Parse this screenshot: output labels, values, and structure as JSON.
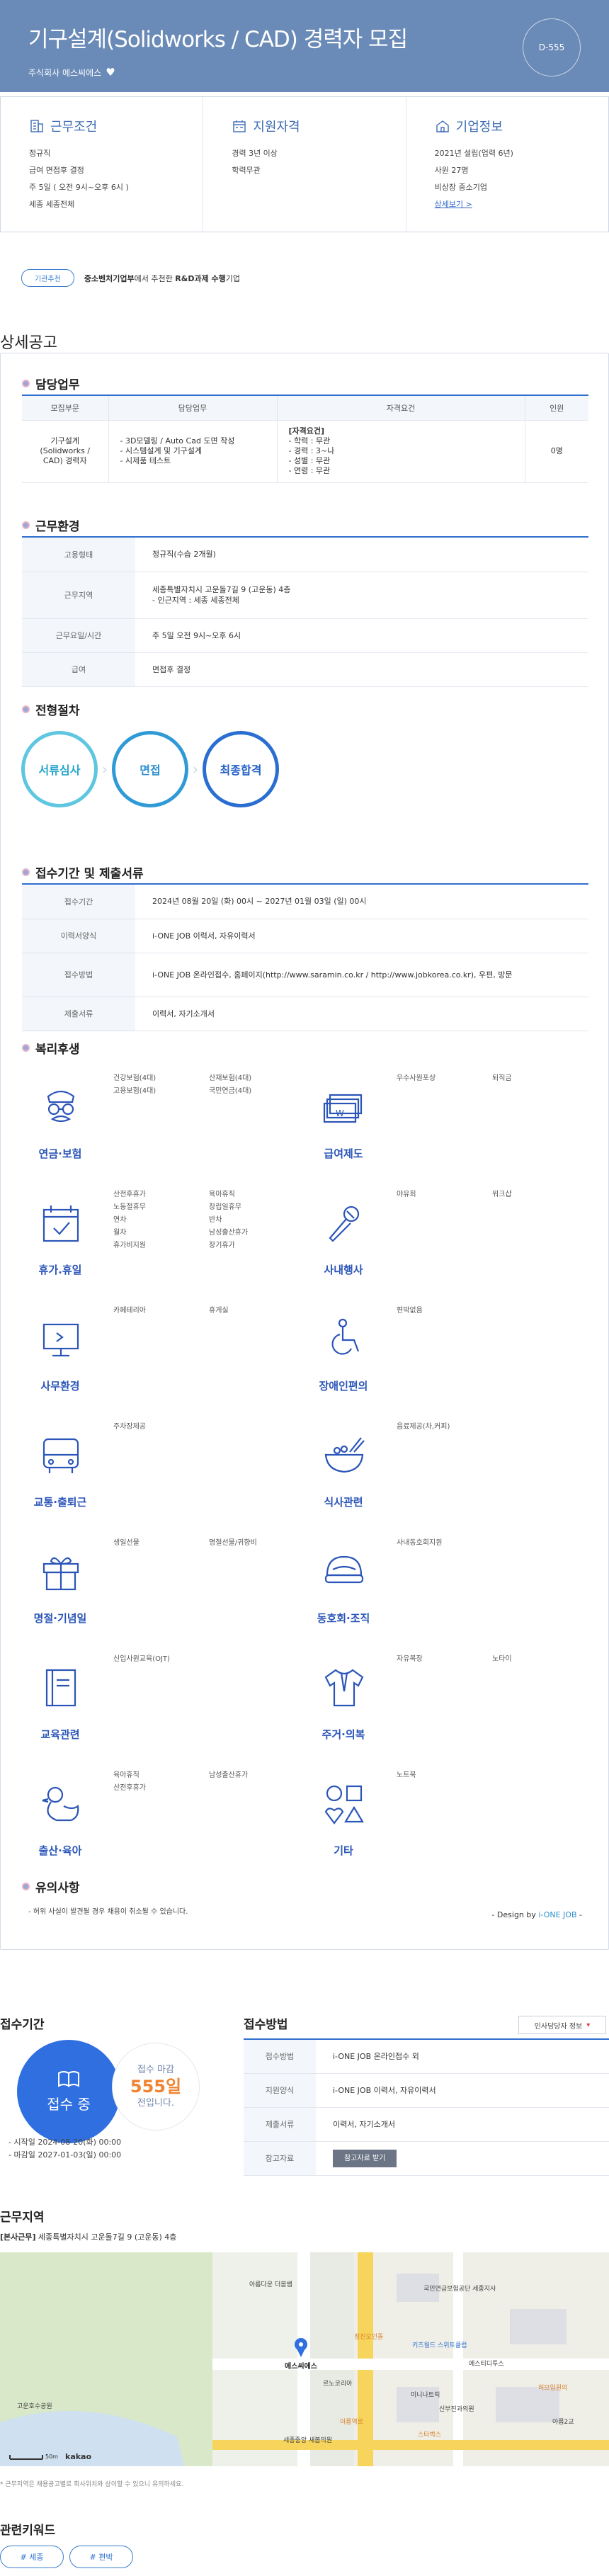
{
  "hero": {
    "title": "기구설계(Solidworks / CAD) 경력자 모집",
    "company": "주식회사 에스씨에스",
    "dday": "D-555",
    "bg": "#6a8ab7"
  },
  "summary": [
    {
      "head": "근무조건",
      "icon": "building-icon",
      "lines": [
        "정규직",
        "급여 면접후 결정",
        "주 5일 ( 오전 9시~오후 6시 )",
        "세종 세종전체"
      ]
    },
    {
      "head": "지원자격",
      "icon": "calendar-icon",
      "lines": [
        "경력 3년 이상",
        "학력무관"
      ]
    },
    {
      "head": "기업정보",
      "icon": "house-icon",
      "lines": [
        "2021년 설립(업력 6년)",
        "사원 27명",
        "비상장 중소기업"
      ],
      "link": "상세보기 >"
    }
  ],
  "rec": {
    "pill": "기관추천",
    "agency": "중소벤처기업부",
    "mid": "에서 추천한",
    "program": "R&D과제 수행",
    "end": "기업"
  },
  "detail_title": "상세공고",
  "sections": {
    "duty": "담당업무",
    "env": "근무환경",
    "process": "전형절차",
    "period": "접수기간 및 제출서류",
    "welfare": "복리후생",
    "caution": "유의사항"
  },
  "duty_table": {
    "headers": [
      "모집부문",
      "담당업무",
      "자격요건",
      "인원"
    ],
    "row": {
      "part": "기구설계(Solidworks / CAD) 경력자",
      "tasks": [
        "- 3D모델링 / Auto Cad 도면 작성",
        "- 시스템설계 및 기구설계",
        "- 시제품 테스트"
      ],
      "req_title": "[자격요건]",
      "req": [
        "- 학력 : 무관",
        "- 경력 : 3~나",
        "- 성별 : 무관",
        "- 연령 : 무관"
      ],
      "count": "0명"
    }
  },
  "env_table": [
    {
      "k": "고용형태",
      "v": "정규직(수습 2개월)"
    },
    {
      "k": "근무지역",
      "v": "세종특별자치시 고운돌7길 9 (고운동) 4층",
      "v2": "- 인근지역 : 세종 세종전체"
    },
    {
      "k": "근무요일/시간",
      "v": "주 5일 오전 9시~오후 6시"
    },
    {
      "k": "급여",
      "v": "면접후 결정"
    }
  ],
  "process": [
    "서류심사",
    "면접",
    "최종합격"
  ],
  "period_table": [
    {
      "k": "접수기간",
      "v": "2024년 08월 20일 (화) 00시 ~ 2027년 01월 03일 (일) 00시"
    },
    {
      "k": "이력서양식",
      "v": "i-ONE JOB 이력서, 자유이력서"
    },
    {
      "k": "접수방법",
      "v": "i-ONE JOB 온라인접수, 홈페이지(http://www.saramin.co.kr / http://www.jobkorea.co.kr), 우편, 방문"
    },
    {
      "k": "제출서류",
      "v": "이력서, 자기소개서"
    }
  ],
  "welfare": [
    {
      "name": "연금·보험",
      "icon": "glasses-mustache-icon",
      "items": [
        "건강보험(4대)",
        "산재보험(4대)",
        "고용보험(4대)",
        "국민연금(4대)"
      ]
    },
    {
      "name": "급여제도",
      "icon": "money-stack-icon",
      "items": [
        "우수사원포상",
        "퇴직금"
      ]
    },
    {
      "name": "휴가.휴일",
      "icon": "calendar-check-icon",
      "items": [
        "산전후휴가",
        "육아휴직",
        "노동절휴무",
        "창립일휴무",
        "연차",
        "반차",
        "월차",
        "남성출산휴가",
        "휴가비지원",
        "장기휴가"
      ]
    },
    {
      "name": "사내행사",
      "icon": "microphone-icon",
      "items": [
        "야유회",
        "워크샵"
      ]
    },
    {
      "name": "사무환경",
      "icon": "monitor-icon",
      "items": [
        "카페테리아",
        "휴게실"
      ]
    },
    {
      "name": "장애인편의",
      "icon": "wheelchair-icon",
      "items": [
        "편박없음"
      ]
    },
    {
      "name": "교통·출퇴근",
      "icon": "bus-icon",
      "items": [
        "주차장제공"
      ]
    },
    {
      "name": "식사관련",
      "icon": "bowl-icon",
      "items": [
        "음료제공(차,커피)"
      ]
    },
    {
      "name": "명절·기념일",
      "icon": "gift-icon",
      "items": [
        "생일선물",
        "명절선물/귀향비"
      ]
    },
    {
      "name": "동호회·조직",
      "icon": "helmet-icon",
      "items": [
        "사내동호회지원"
      ]
    },
    {
      "name": "교육관련",
      "icon": "book-icon",
      "items": [
        "신입사원교육(OJT)"
      ]
    },
    {
      "name": "주거·의복",
      "icon": "shirt-icon",
      "items": [
        "자유복장",
        "노타이"
      ]
    },
    {
      "name": "출산·육아",
      "icon": "duck-icon",
      "items": [
        "육아휴직",
        "남성출산휴가",
        "산전후휴가"
      ]
    },
    {
      "name": "기타",
      "icon": "shapes-icon",
      "items": [
        "노트북"
      ]
    }
  ],
  "caution_text": "- 허위 사실이 발견될 경우 채용이 취소될 수 있습니다.",
  "design": {
    "pre": "- Design by",
    "brand": "i-ONE JOB",
    "post": "-"
  },
  "apply": {
    "title": "접수기간",
    "status": "접수 중",
    "deadline_pre": "접수 마감",
    "deadline": "555일",
    "deadline_post": "전입니다.",
    "start": "- 시작일 2024-08-20(화) 00:00",
    "end": "- 마감일 2027-01-03(일) 00:00"
  },
  "method": {
    "title": "접수방법",
    "mgr_label": "인사담당자 정보",
    "rows": [
      {
        "k": "접수방법",
        "v": "i-ONE JOB 온라인접수 외"
      },
      {
        "k": "지원양식",
        "v": "i-ONE JOB 이력서, 자유이력서"
      },
      {
        "k": "제출서류",
        "v": "이력서, 자기소개서"
      },
      {
        "k": "참고자료",
        "v": "참고자료 받기"
      }
    ]
  },
  "location": {
    "title": "근무지역",
    "tag": "[본사근무]",
    "addr": "세종특별자치시 고운돌7길 9 (고운동) 4층",
    "note": "* 근무지역은 채용공고별로 회사위치와 상이할 수 있으니 유의하세요.",
    "map_labels": [
      "아름다운 더봄쌤",
      "국민연금보험공단 세종지사",
      "에스씨에스",
      "고운호수공원",
      "르노코리아",
      "키즈월드 스위트클럽",
      "에스티디투스",
      "허브입원의",
      "미니나트릭",
      "신부진과의원",
      "아름2교",
      "정진오인돌",
      "세종중앙 새봄의원",
      "아름역로",
      "스타벅스",
      "50m",
      "kakao"
    ]
  },
  "keywords": {
    "title": "관련키워드",
    "items": [
      "# 세종",
      "# 편박"
    ]
  }
}
